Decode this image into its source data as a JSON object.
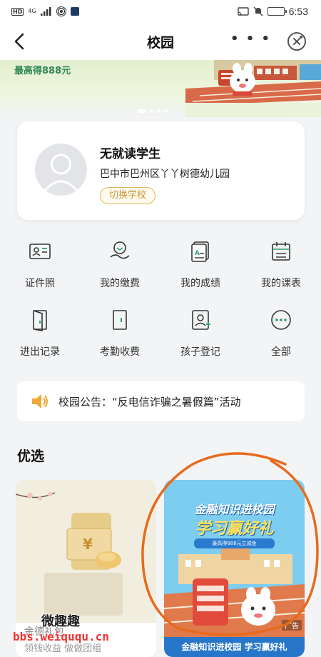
{
  "status_bar": {
    "time": "6:53",
    "left_hd": "HD",
    "left_net": "4G"
  },
  "nav": {
    "title": "校园",
    "more": "• • •"
  },
  "banner": {
    "text": "最高得888元"
  },
  "profile": {
    "name": "无就读学生",
    "school": "巴中市巴州区丫丫树德幼儿园",
    "switch_label": "切换学校"
  },
  "grid": [
    {
      "label": "证件照",
      "icon": "id-card-icon"
    },
    {
      "label": "我的缴费",
      "icon": "payment-icon"
    },
    {
      "label": "我的成绩",
      "icon": "grades-icon"
    },
    {
      "label": "我的课表",
      "icon": "schedule-icon"
    },
    {
      "label": "进出记录",
      "icon": "door-icon"
    },
    {
      "label": "考勤收费",
      "icon": "attendance-icon"
    },
    {
      "label": "孩子登记",
      "icon": "child-register-icon"
    },
    {
      "label": "全部",
      "icon": "more-icon"
    }
  ],
  "notice": {
    "text": "校园公告：“反电信诈骗之暑假篇”活动"
  },
  "section": {
    "title": "优选"
  },
  "cards": {
    "left": {
      "caption": "金德礼包",
      "caption2": "领钱收益 做做团组"
    },
    "right": {
      "line1": "金融知识进校园",
      "line2": "学习赢好礼",
      "badge": "最高得888元立减金",
      "ad": "广告",
      "bottom": "金融知识进校园 学习赢好礼"
    }
  },
  "watermark": {
    "line1": "微趣趣",
    "line2": "bbs.weiququ.cn"
  },
  "colors": {
    "accent_gold": "#c79a36",
    "banner_green": "#2f8a55",
    "scribble_orange": "#e86a1c"
  }
}
